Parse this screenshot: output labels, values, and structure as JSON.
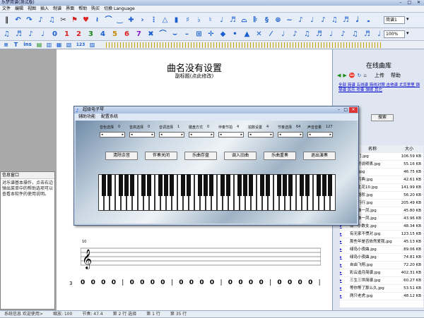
{
  "window": {
    "title": "乐梦简谱(测试版)"
  },
  "menubar": [
    "文件",
    "编辑",
    "视图",
    "插入",
    "制谱",
    "界面",
    "帮助",
    "购买",
    "切换 Language"
  ],
  "toolbar2_numbers": [
    "0",
    "1",
    "2",
    "3",
    "4",
    "5",
    "6",
    "7"
  ],
  "toolbar3": {
    "ins_label": "ins",
    "num_label": "123"
  },
  "zoom": {
    "value": "100%"
  },
  "right_select": {
    "value": "简谱1"
  },
  "score": {
    "title": "曲名没有设置",
    "subtitle": "副标题(点此修改)",
    "measure_number": "10",
    "row_number": "3",
    "notes_row": [
      "0",
      "0",
      "0",
      "0",
      "0",
      "0",
      "0",
      "0",
      "0",
      "0",
      "0",
      "0",
      "0",
      "0",
      "0",
      "0",
      "0",
      "0",
      "0",
      "0",
      "0",
      "0"
    ]
  },
  "info_panel": {
    "title": "信息窗口",
    "text": "对乐谱基本操作，点击右边弹出菜单中的帮助选项可以查看本软件的使用说明。"
  },
  "dialog": {
    "title": "超级电子琴",
    "menu": [
      "辅助功能",
      "配置系统"
    ],
    "controls": [
      "音色选择",
      "音高选择",
      "音调选择",
      "键盘方式",
      "伴奏节拍",
      "拍数设置",
      "节奏选择",
      "声音音量"
    ],
    "control_values": [
      "0",
      "0",
      "1",
      "0",
      "4",
      "4",
      "64",
      "127"
    ],
    "buttons": [
      "清除余音",
      "伴奏关闭",
      "乐曲存盘",
      "调入旧曲",
      "乐曲重奏",
      "退出演奏"
    ]
  },
  "right_panel": {
    "title": "在线曲库",
    "nav": [
      "上传",
      "帮助"
    ],
    "links": "全部 简谱 五线谱 简线对照 吉他谱 尤克里里 钢琴谱 民乐 吹奏 弹拨 其它",
    "search_btn": "搜索",
    "head_name": "名称",
    "head_size": "大小",
    "files": [
      {
        "n": "梨飞门.jpg",
        "s": "106.59 KB"
      },
      {
        "n": "翡翠号说明表.jpg",
        "s": "55.16 KB"
      },
      {
        "n": "乐曲.jpg",
        "s": "46.75 KB"
      },
      {
        "n": "五的可典.jpg",
        "s": "42.61 KB"
      },
      {
        "n": "一路生花10.jpg",
        "s": "141.99 KB"
      },
      {
        "n": "新一路阶.jpg",
        "s": "56.20 KB"
      },
      {
        "n": "无间行行.jpg",
        "s": "205.49 KB"
      },
      {
        "n": "有一株一凤.jpg",
        "s": "45.80 KB"
      },
      {
        "n": "有一株一凤.jpg",
        "s": "43.96 KB"
      },
      {
        "n": "荷一小数支.jpg",
        "s": "48.34 KB"
      },
      {
        "n": "有无家不惯对.jpg",
        "s": "123.15 KB"
      },
      {
        "n": "那些年是否依然爱我.jpg",
        "s": "45.13 KB"
      },
      {
        "n": "绿岛小夜曲.jpg",
        "s": "89.06 KB"
      },
      {
        "n": "绿岛小夜曲.jpg",
        "s": "74.81 KB"
      },
      {
        "n": "自由飞翔.jpg",
        "s": "72.20 KB"
      },
      {
        "n": "彩云追月简谱.jpg",
        "s": "402.31 KB"
      },
      {
        "n": "三生三世简谱.jpg",
        "s": "60.27 KB"
      },
      {
        "n": "等你等了那么久.jpg",
        "s": "53.51 KB"
      },
      {
        "n": "两只老虎.jpg",
        "s": "48.12 KB"
      }
    ]
  },
  "statusbar": {
    "left": "系统信息 欢迎使用>",
    "zoom": "缩放: 100",
    "items": [
      "节奏: 47.4",
      "第 2 行 选择",
      "第 1 行",
      "第 35 行"
    ]
  },
  "colors": {
    "accent": "#2255cc",
    "piano_bg": "#9fb3c6",
    "link": "#0000cc"
  }
}
